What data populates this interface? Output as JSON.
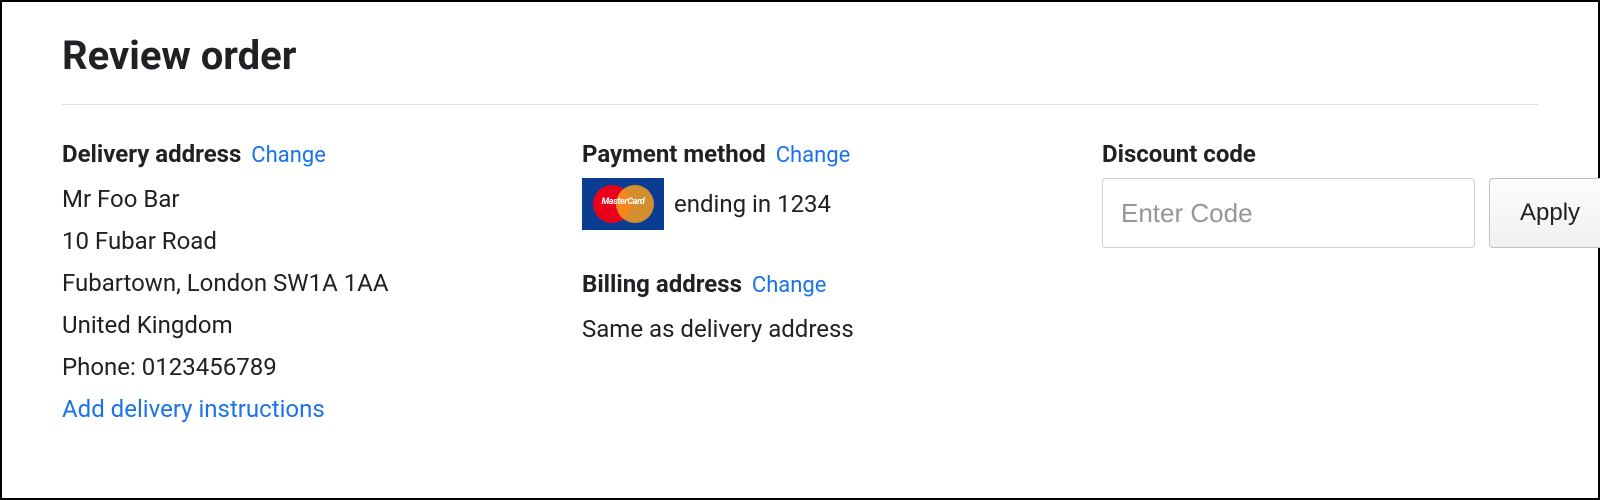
{
  "page_title": "Review order",
  "delivery": {
    "heading": "Delivery address",
    "change_label": "Change",
    "name": "Mr Foo Bar",
    "street": "10 Fubar Road",
    "city_line": "Fubartown, London SW1A 1AA",
    "country": "United Kingdom",
    "phone": "Phone: 0123456789",
    "add_instructions": "Add delivery instructions"
  },
  "payment": {
    "heading": "Payment method",
    "change_label": "Change",
    "card_brand": "MasterCard",
    "ending_text": "ending in 1234"
  },
  "billing": {
    "heading": "Billing address",
    "change_label": "Change",
    "text": "Same as delivery address"
  },
  "discount": {
    "heading": "Discount code",
    "placeholder": "Enter Code",
    "apply_label": "Apply"
  }
}
